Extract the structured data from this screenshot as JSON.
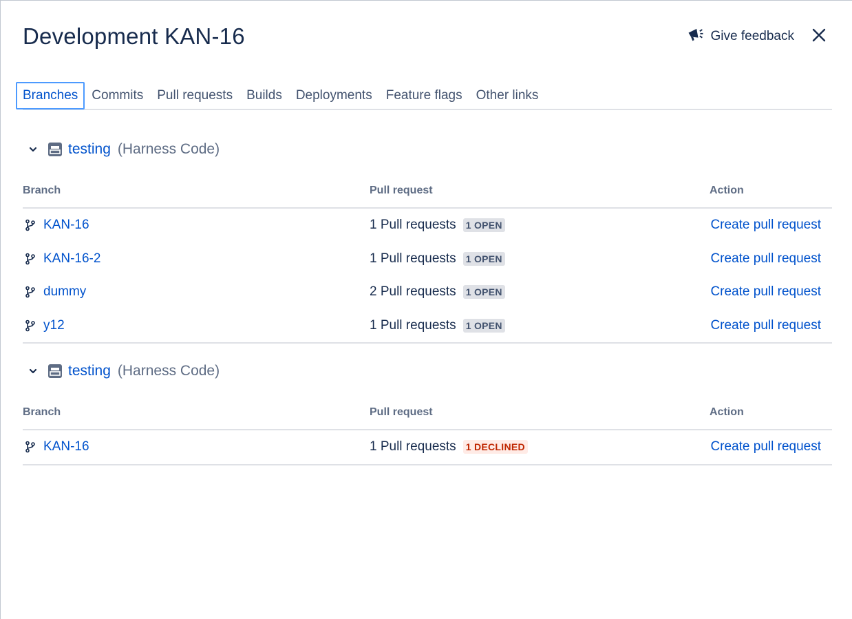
{
  "header": {
    "title": "Development KAN-16",
    "feedback_label": "Give feedback"
  },
  "tabs": [
    {
      "label": "Branches",
      "active": true
    },
    {
      "label": "Commits"
    },
    {
      "label": "Pull requests"
    },
    {
      "label": "Builds"
    },
    {
      "label": "Deployments"
    },
    {
      "label": "Feature flags"
    },
    {
      "label": "Other links"
    }
  ],
  "columns": {
    "branch": "Branch",
    "pull_request": "Pull request",
    "action": "Action"
  },
  "groups": [
    {
      "repo": "testing",
      "source": "(Harness Code)",
      "rows": [
        {
          "branch": "KAN-16",
          "pr": "1 Pull requests",
          "status": "1 OPEN",
          "action": "Create pull request"
        },
        {
          "branch": "KAN-16-2",
          "pr": "1 Pull requests",
          "status": "1 OPEN",
          "action": "Create pull request"
        },
        {
          "branch": "dummy",
          "pr": "2 Pull requests",
          "status": "1 OPEN",
          "action": "Create pull request"
        },
        {
          "branch": "y12",
          "pr": "1 Pull requests",
          "status": "1 OPEN",
          "action": "Create pull request"
        }
      ]
    },
    {
      "repo": "testing",
      "source": "(Harness Code)",
      "rows": [
        {
          "branch": "KAN-16",
          "pr": "1 Pull requests",
          "status": "1 DECLINED",
          "action": "Create pull request"
        }
      ]
    }
  ],
  "colors": {
    "link": "#0052cc",
    "text": "#172b4d",
    "open_bg": "#dfe1e6",
    "declined_bg": "#ffebe6",
    "declined_text": "#bf2600"
  },
  "icons": {
    "feedback": "megaphone-icon",
    "close": "close-icon",
    "chevron": "chevron-down-icon",
    "repo": "repository-icon",
    "branch": "branch-icon"
  }
}
